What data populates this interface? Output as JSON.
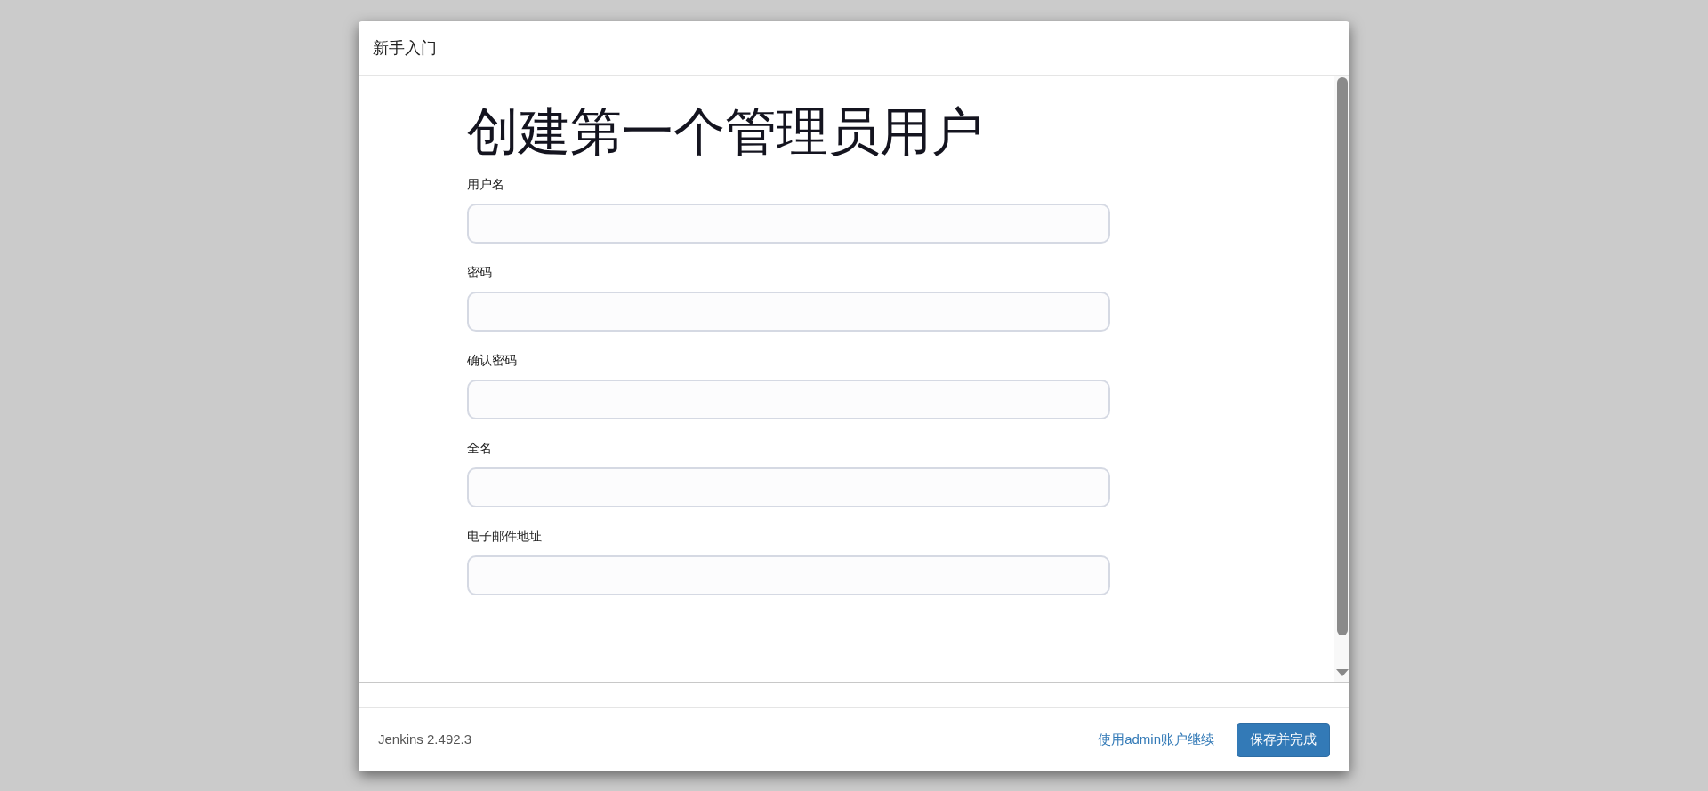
{
  "dialog": {
    "title": "新手入门"
  },
  "form": {
    "heading": "创建第一个管理员用户",
    "fields": [
      {
        "label": "用户名"
      },
      {
        "label": "密码"
      },
      {
        "label": "确认密码"
      },
      {
        "label": "全名"
      },
      {
        "label": "电子邮件地址"
      }
    ]
  },
  "footer": {
    "version": "Jenkins 2.492.3",
    "link": "使用admin账户继续",
    "button": "保存并完成"
  }
}
